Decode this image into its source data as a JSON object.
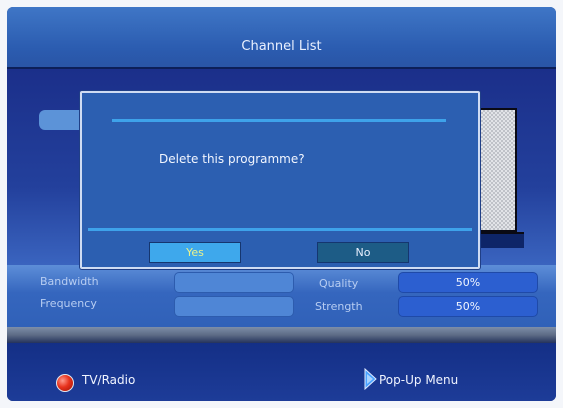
{
  "header": {
    "title": "Channel List"
  },
  "dialog": {
    "message": "Delete this programme?",
    "yes_label": "Yes",
    "no_label": "No"
  },
  "info": {
    "bandwidth_label": "Bandwidth",
    "frequency_label": "Frequency",
    "quality_label": "Quality",
    "quality_value": "50%",
    "strength_label": "Strength",
    "strength_value": "50%"
  },
  "footer": {
    "tv_radio_label": "TV/Radio",
    "popup_menu_label": "Pop-Up Menu"
  },
  "icons": {
    "tv_radio": "red-circle-button-icon",
    "popup_menu": "blue-arrow-button-icon"
  },
  "colors": {
    "background": "#0e2c78",
    "dialog": "#2c5fb1",
    "selected_button": "#3ea8ec",
    "accent_line": "#3ea2ea"
  }
}
